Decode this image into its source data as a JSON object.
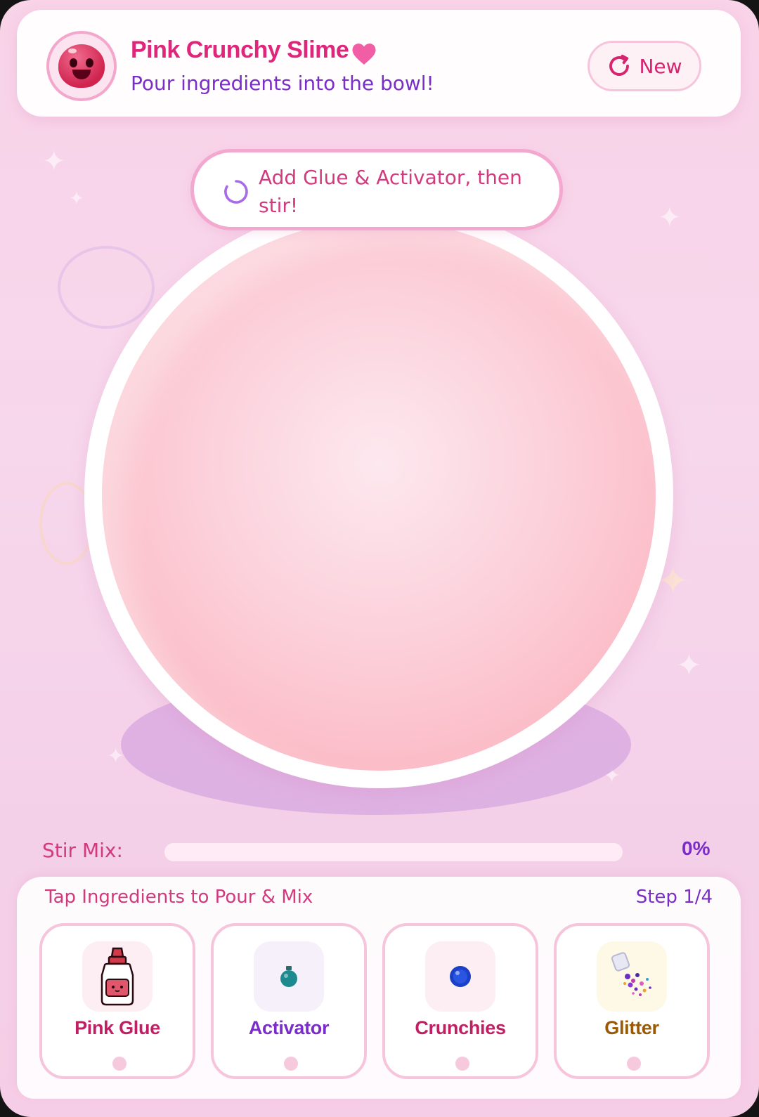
{
  "header": {
    "title": "Pink Crunchy Slime",
    "subtitle": "Pour ingredients into the bowl!",
    "new_button_label": "New",
    "avatar_icon": "slime-face-icon",
    "title_icon": "heart-icon"
  },
  "hint": {
    "text": "Add Glue & Activator, then stir!",
    "icon": "spinner-icon"
  },
  "stir": {
    "label": "Stir Mix:",
    "percent_label": "0%",
    "progress": 0
  },
  "ingredients_panel": {
    "title": "Tap Ingredients to Pour & Mix",
    "step_label": "Step 1/4",
    "items": [
      {
        "label": "Pink Glue",
        "icon": "glue-bottle-icon",
        "color": "#c01f63",
        "bg": "#fdeef3"
      },
      {
        "label": "Activator",
        "icon": "potion-bottle-icon",
        "color": "#7a2ec7",
        "bg": "#f6f0fb"
      },
      {
        "label": "Crunchies",
        "icon": "blue-bead-icon",
        "color": "#c01f63",
        "bg": "#fdeef3"
      },
      {
        "label": "Glitter",
        "icon": "glitter-jar-icon",
        "color": "#9a5a05",
        "bg": "#fdf9e6"
      }
    ]
  },
  "colors": {
    "accent_pink": "#e0267a",
    "accent_purple": "#7a2ec7",
    "bowl_pink": "#fbb9c4",
    "card_border": "#f6c5dc"
  }
}
